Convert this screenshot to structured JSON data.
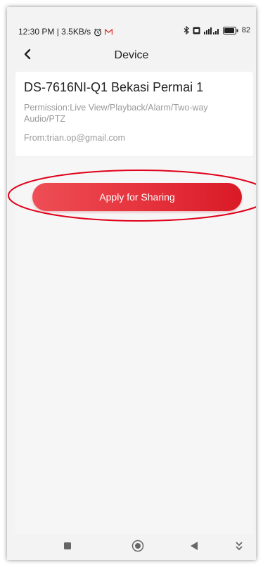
{
  "status_bar": {
    "time_speed": "12:30 PM | 3.5KB/s",
    "battery": "82"
  },
  "nav": {
    "title": "Device"
  },
  "device": {
    "name": "DS-7616NI-Q1 Bekasi Permai 1",
    "permission": "Permission:Live View/Playback/Alarm/Two-way Audio/PTZ",
    "from": "From:trian.op@gmail.com"
  },
  "actions": {
    "apply_label": "Apply for Sharing"
  },
  "colors": {
    "accent": "#e5323c",
    "annotation": "#e0001a"
  },
  "icons": {
    "status": [
      "clock-icon",
      "gmail-icon",
      "bluetooth-icon",
      "sim-icon",
      "signal-icon",
      "battery-icon"
    ],
    "nav": [
      "back-arrow-icon"
    ],
    "system_nav": [
      "recents-icon",
      "home-icon",
      "back-icon",
      "notification-pull-icon"
    ]
  }
}
